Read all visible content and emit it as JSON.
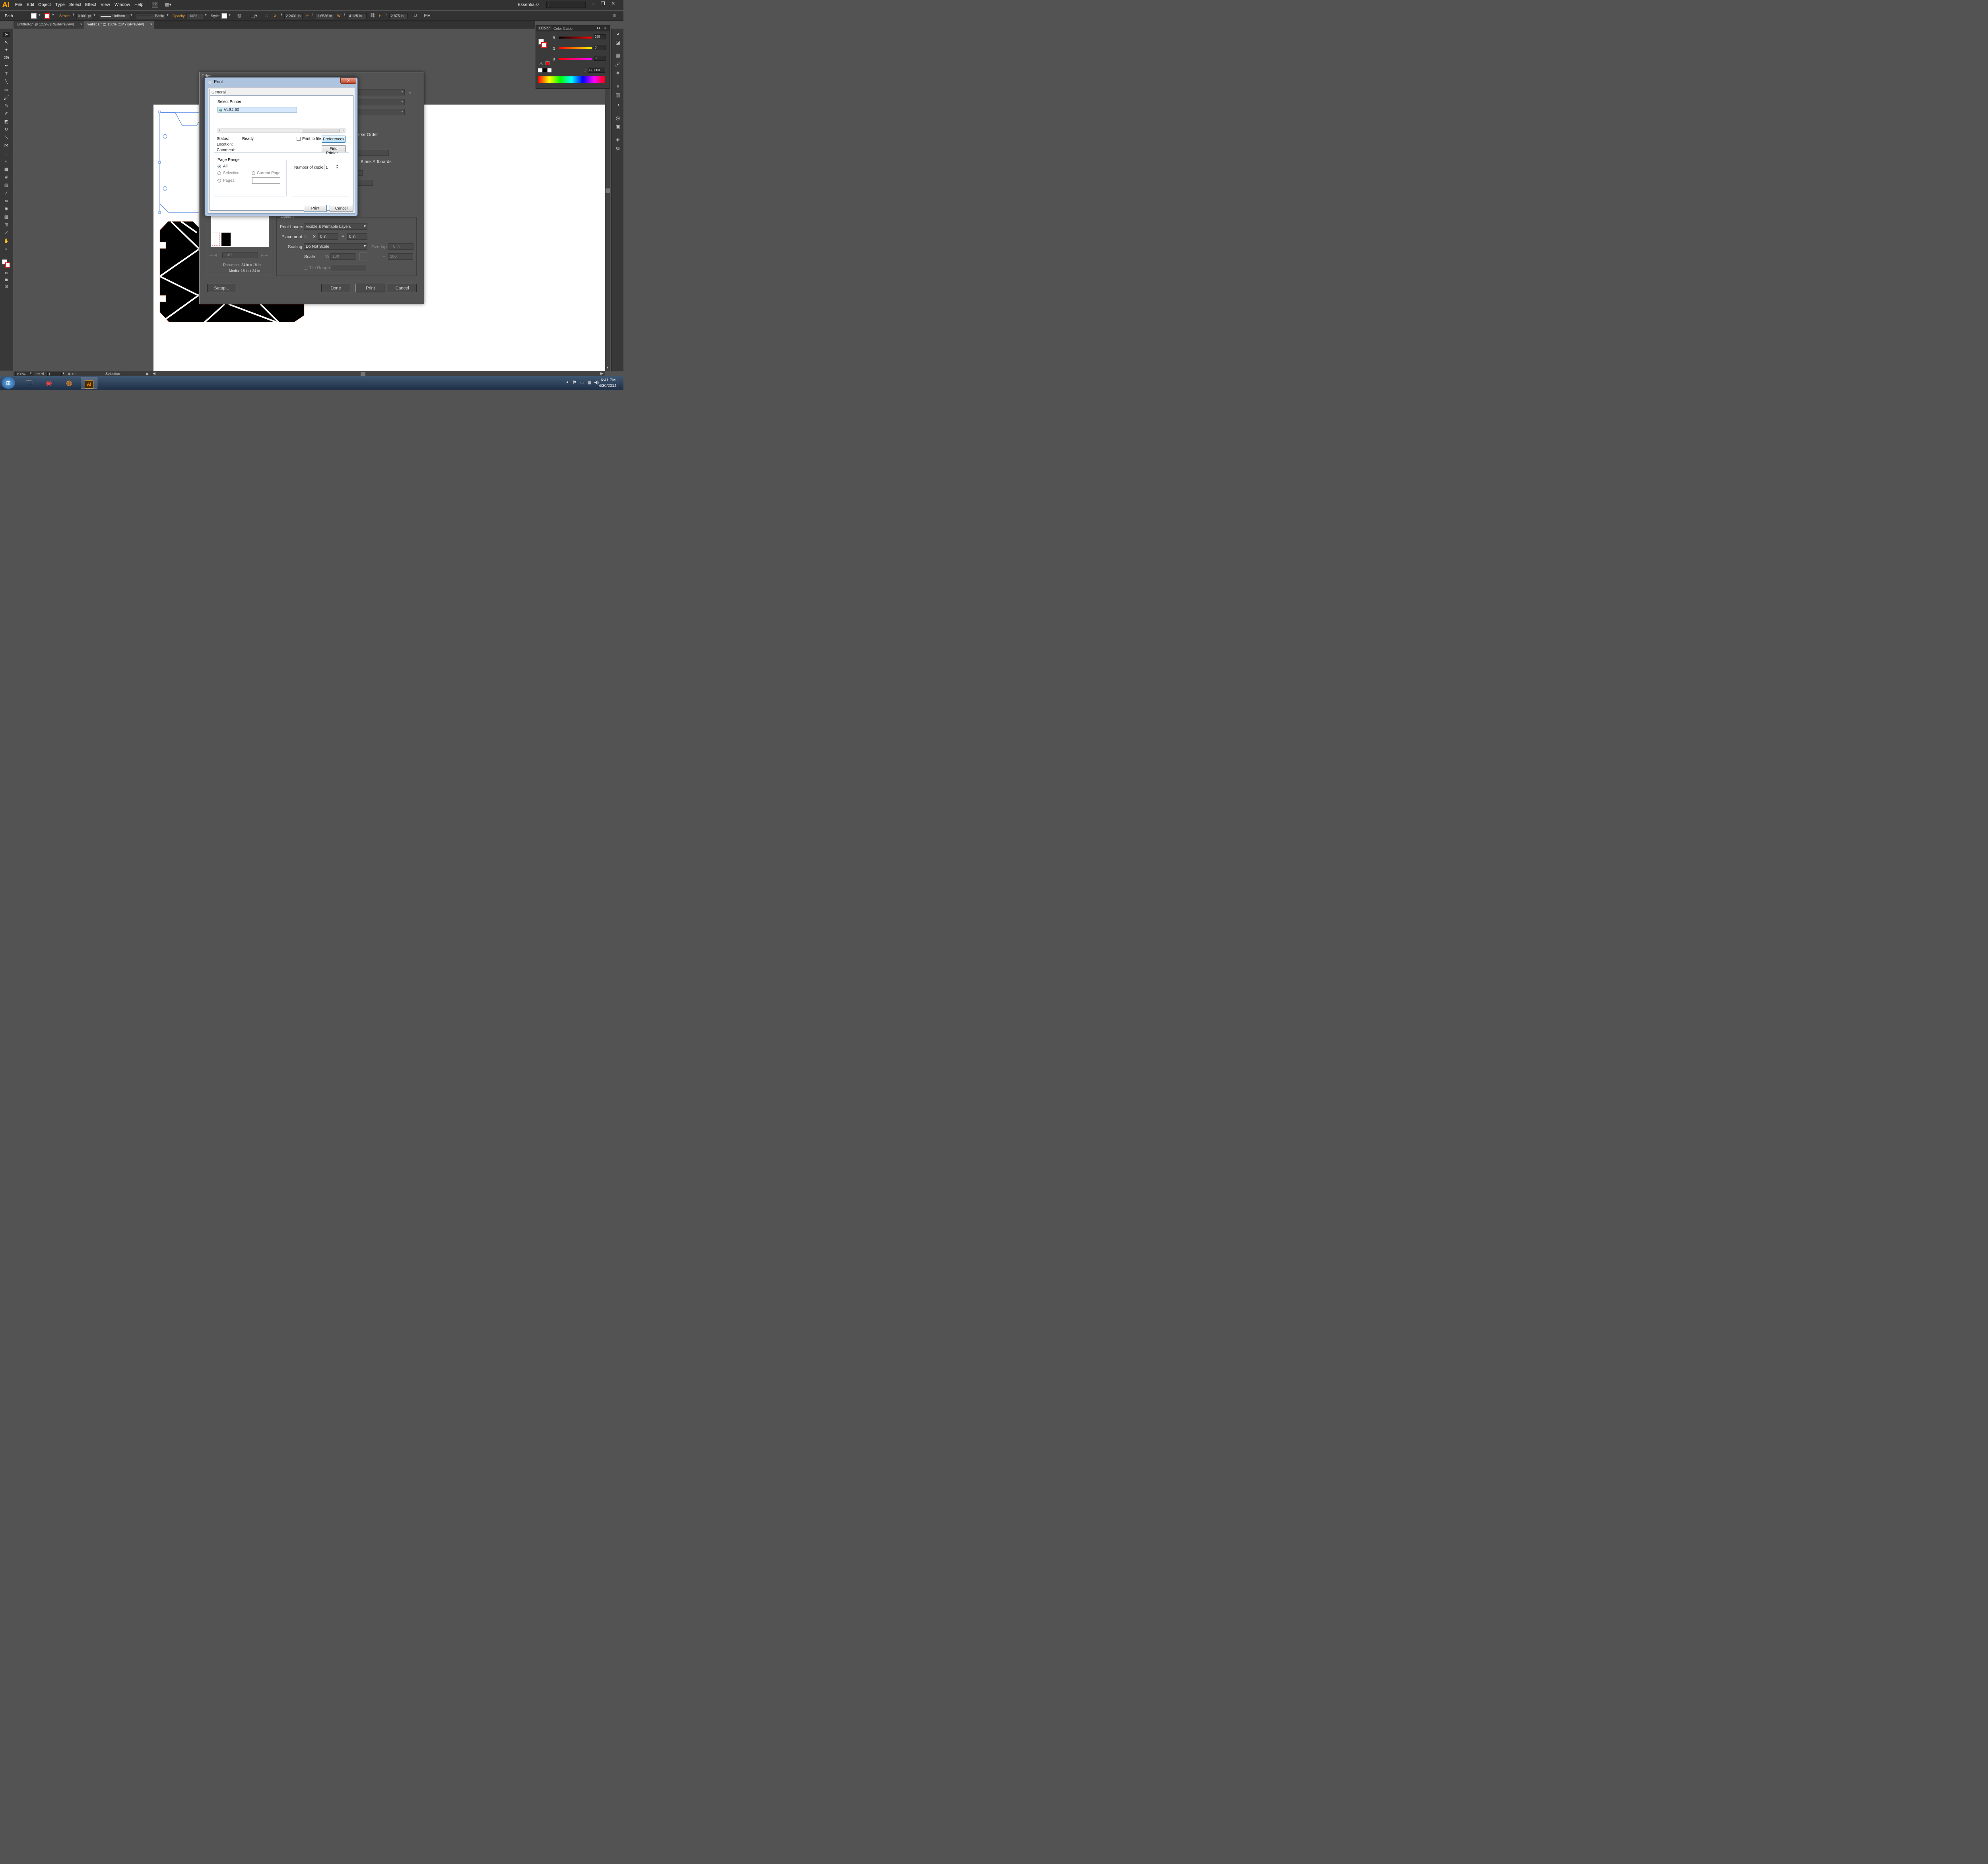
{
  "app": {
    "logo": "Ai",
    "workspace": "Essentials"
  },
  "menu": [
    "File",
    "Edit",
    "Object",
    "Type",
    "Select",
    "Effect",
    "View",
    "Window",
    "Help"
  ],
  "control": {
    "selection_label": "Path",
    "stroke_label": "Stroke:",
    "stroke_value": "0.001 pt",
    "profile_uniform": "Uniform",
    "brush_basic": "Basic",
    "opacity_label": "Opacity:",
    "opacity_value": "100%",
    "style_label": "Style:",
    "x_label": "X:",
    "x_value": "2.2431 in",
    "y_label": "Y:",
    "y_value": "1.6536 in",
    "w_label": "W:",
    "w_value": "4.125 in",
    "h_label": "H:",
    "h_value": "2.875 in"
  },
  "tabs": [
    {
      "label": "Untitled-1* @ 12.5% (RGB/Preview)"
    },
    {
      "label": "wallet.ai* @ 150% (CMYK/Preview)"
    }
  ],
  "color_panel": {
    "tab_color": "Color",
    "tab_guide": "Color Guide",
    "r_label": "R",
    "r_value": "255",
    "g_label": "G",
    "g_value": "0",
    "b_label": "B",
    "b_value": "0",
    "hash": "#",
    "hex_value": "FF0000"
  },
  "print_dialog": {
    "title": "Print",
    "reverse_order": "erse Order",
    "blank_artboards": "Blank Artboards",
    "page_nav": "1 of 1",
    "document_size": "Document: 24 in x 18 in",
    "media_size": "Media: 18 in x 24 in",
    "options_header": "Options",
    "print_layers_label": "Print Layers:",
    "print_layers_value": "Visible & Printable Layers",
    "placement_label": "Placement:",
    "x_label": "X:",
    "x_value": "0 in",
    "y_label": "Y:",
    "y_value": "0 in",
    "scaling_label": "Scaling:",
    "scaling_value": "Do Not Scale",
    "overlap_label": "Overlap:",
    "overlap_value": "0 in",
    "scale_label": "Scale:",
    "w_label": "W:",
    "w_value": "100",
    "h_label": "H:",
    "h_value": "100",
    "tile_range_label": "Tile Range:",
    "setup_btn": "Setup...",
    "done_btn": "Done",
    "print_btn": "Print",
    "cancel_btn": "Cancel"
  },
  "win_print": {
    "title": "Print",
    "tab_general": "General",
    "select_printer": "Select Printer",
    "printer_name": "VLS4.60",
    "status_label": "Status:",
    "status_value": "Ready",
    "location_label": "Location:",
    "comment_label": "Comment:",
    "print_to_file": "Print to file",
    "preferences_btn": "Preferences",
    "find_printer_btn": "Find Printer...",
    "page_range": "Page Range",
    "all": "All",
    "selection": "Selection",
    "current_page": "Current Page",
    "pages": "Pages:",
    "copies_label": "Number of copies:",
    "copies_value": "1",
    "print_btn": "Print",
    "cancel_btn": "Cancel",
    "close_glyph": "✕"
  },
  "status_bar": {
    "zoom": "150%",
    "artboard": "1",
    "tool": "Selection"
  },
  "taskbar": {
    "time": "6:41 PM",
    "date": "4/30/2014"
  }
}
